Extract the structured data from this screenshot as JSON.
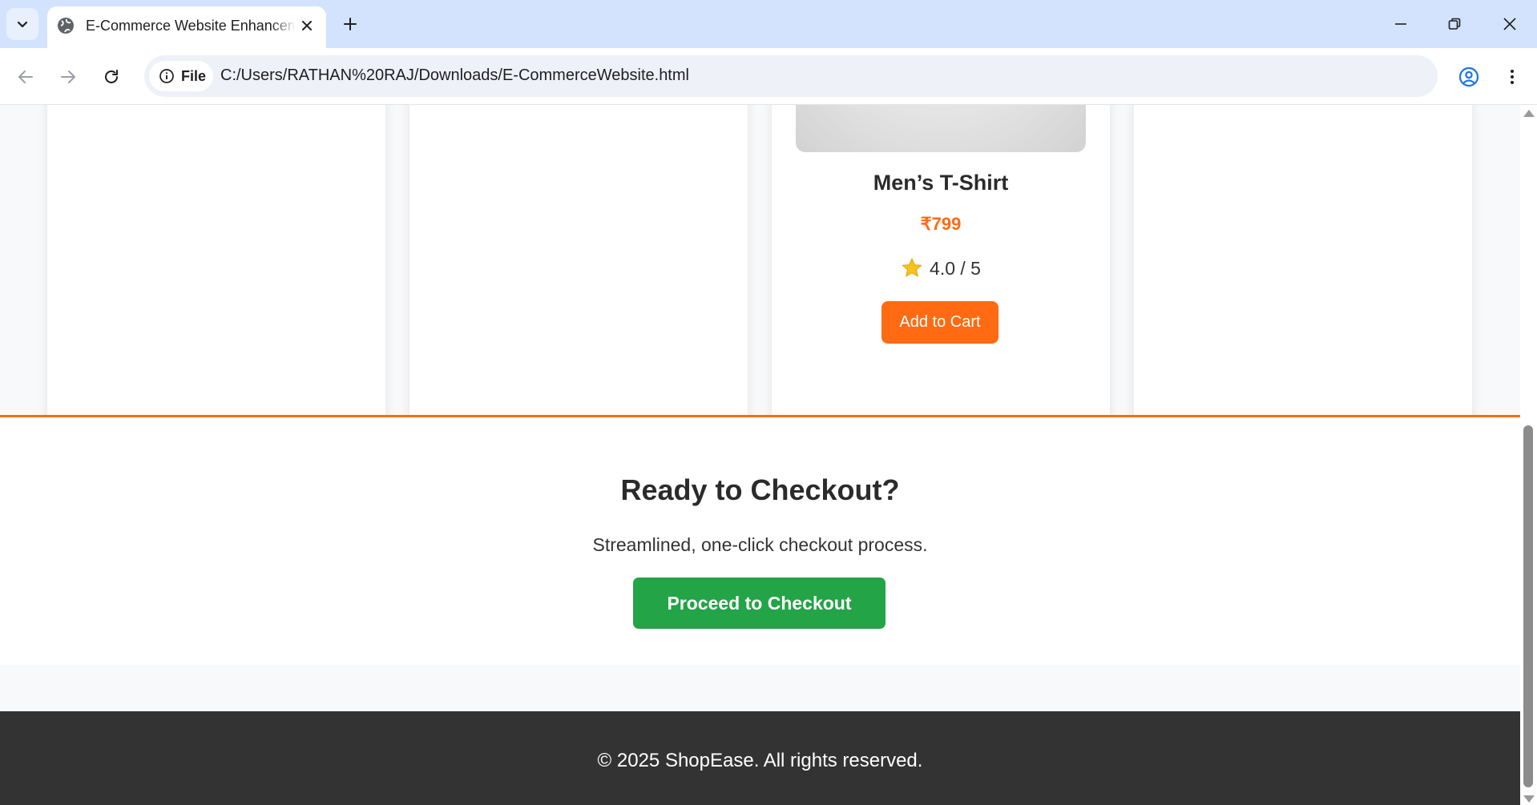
{
  "browser": {
    "tab_title": "E-Commerce Website Enhancements",
    "site_chip_label": "File",
    "url": "C:/Users/RATHAN%20RAJ/Downloads/E-CommerceWebsite.html"
  },
  "products": {
    "featured": {
      "name": "Men’s T-Shirt",
      "price": "₹799",
      "rating": "4.0 / 5",
      "cart_label": "Add to Cart"
    }
  },
  "checkout": {
    "title": "Ready to Checkout?",
    "subtitle": "Streamlined, one-click checkout process.",
    "button_label": "Proceed to Checkout"
  },
  "footer": {
    "text": "© 2025 ShopEase. All rights reserved."
  },
  "colors": {
    "accent": "#ff6a13",
    "checkout_button": "#22a447",
    "footer_bg": "#333333",
    "tabbar_bg": "#d3e3fd"
  },
  "icons": [
    "tab-list-chevron-icon",
    "globe-icon",
    "close-icon",
    "plus-icon",
    "minimize-icon",
    "restore-icon",
    "window-close-icon",
    "back-arrow-icon",
    "forward-arrow-icon",
    "reload-icon",
    "info-icon",
    "star-outline-icon",
    "profile-icon",
    "more-vert-icon",
    "star-icon"
  ]
}
